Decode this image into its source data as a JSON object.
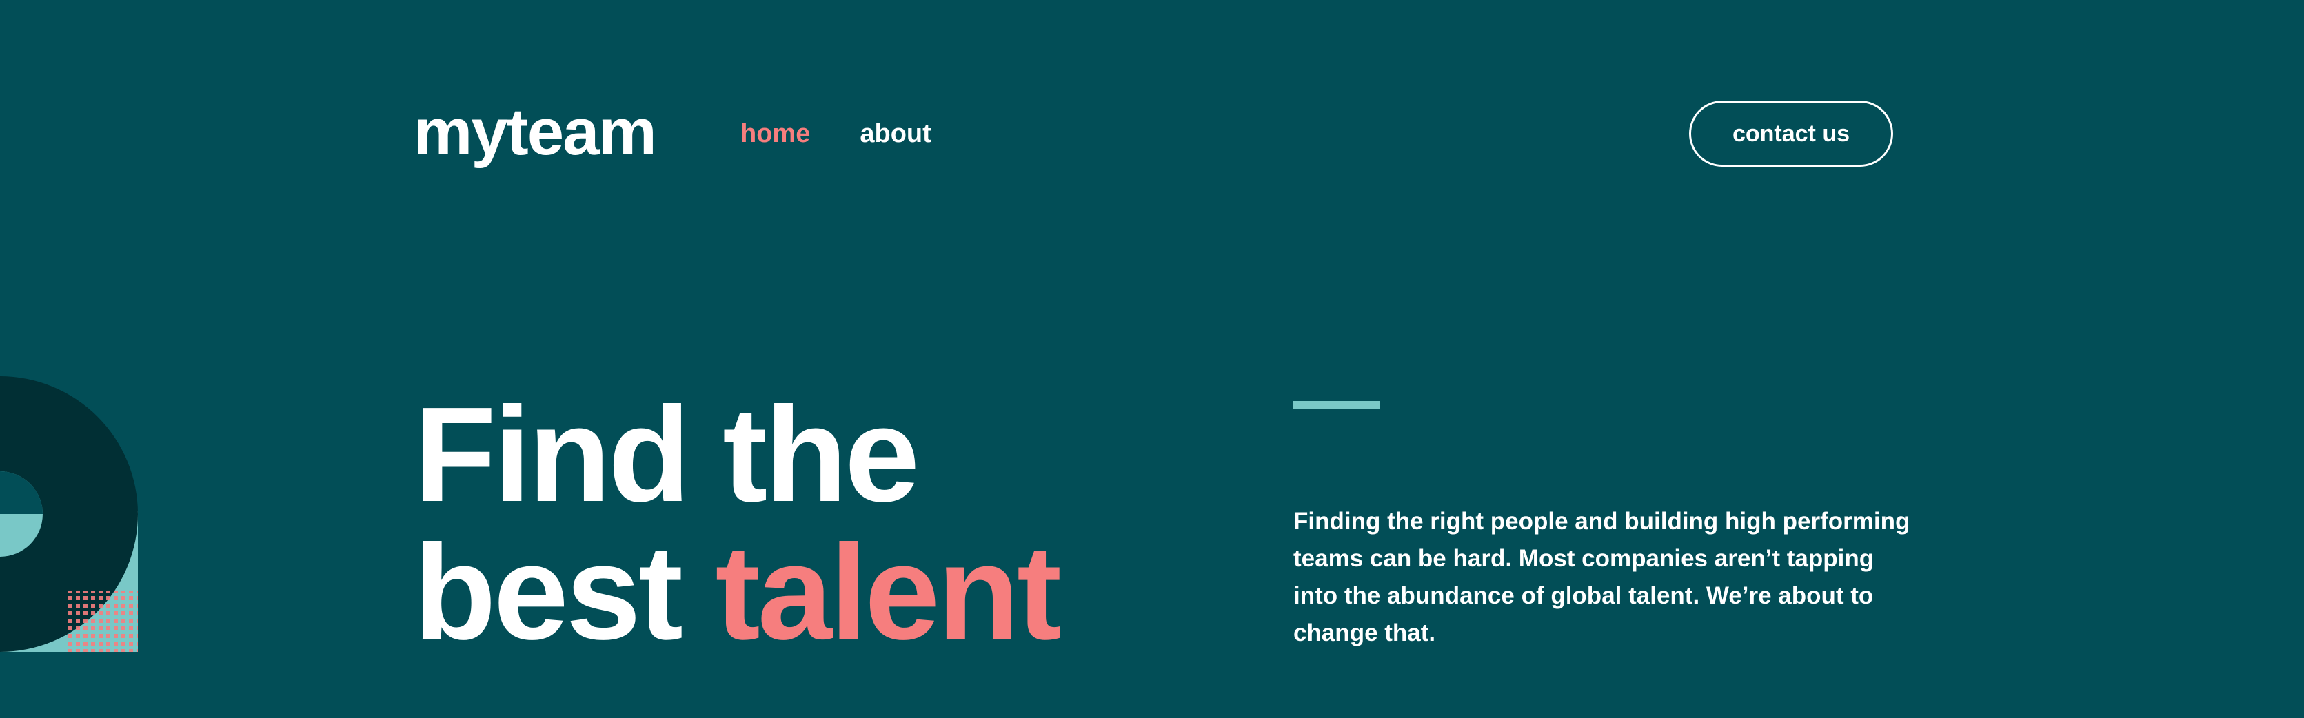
{
  "header": {
    "logo": "myteam",
    "nav": [
      {
        "label": "home",
        "active": true
      },
      {
        "label": "about",
        "active": false
      }
    ],
    "contact_label": "contact us"
  },
  "hero": {
    "title_line1": "Find the",
    "title_line2_plain": "best",
    "title_line2_accent": "talent",
    "description": "Finding the right people and building high performing teams can be hard. Most companies aren’t tapping into the abundance of global talent. We’re about to change that."
  },
  "colors": {
    "background": "#024e57",
    "accent": "#f67e7e",
    "teal": "#79c8c7",
    "dark": "#012f34",
    "white": "#ffffff"
  },
  "icons": {
    "decor": "circle-pattern-decoration"
  }
}
